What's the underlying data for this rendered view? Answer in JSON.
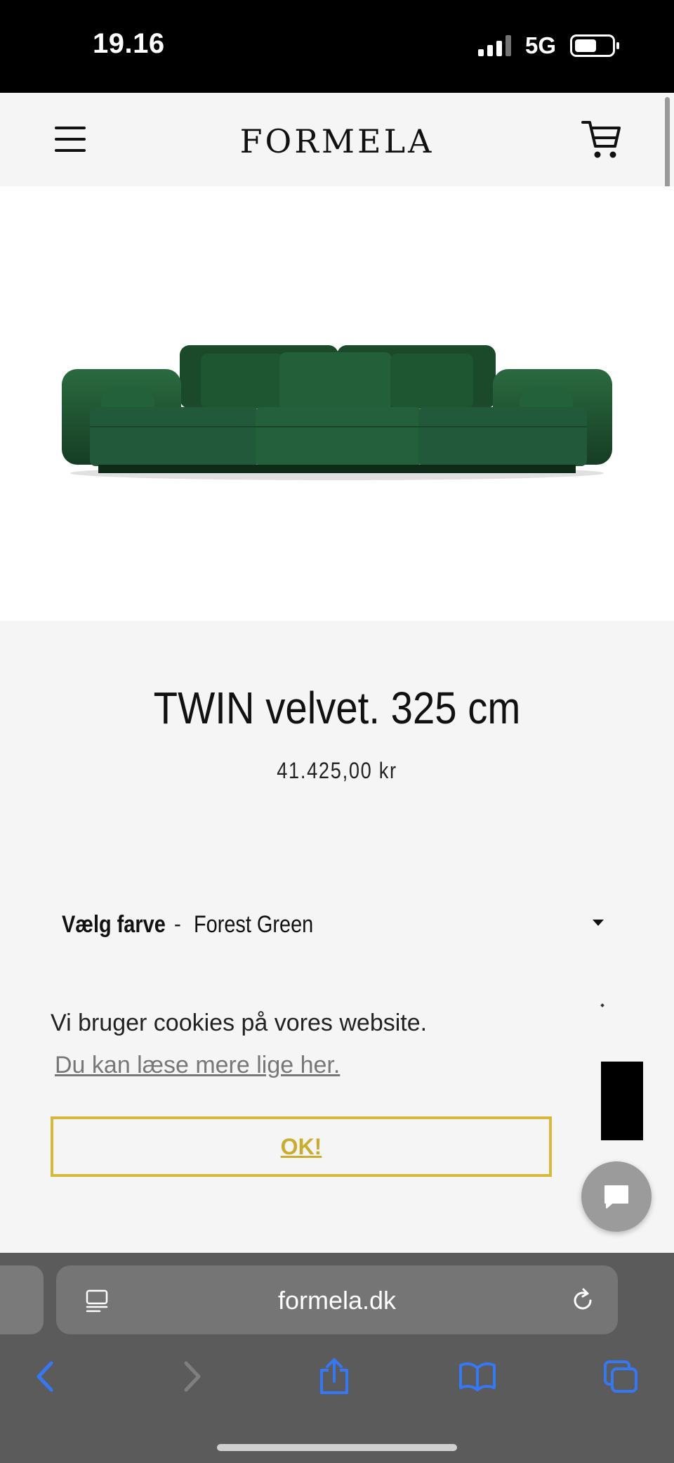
{
  "status_bar": {
    "time": "19.16",
    "network": "5G"
  },
  "header": {
    "logo": "FORMELA"
  },
  "product": {
    "title": "TWIN velvet. 325 cm",
    "price": "41.425,00 kr",
    "variant_label": "Vælg farve",
    "variant_separator": "-",
    "variant_value": "Forest Green",
    "sofa_color": "#1f4d2e"
  },
  "cookie": {
    "message": "Vi bruger cookies på vores website.",
    "link_text": "Du kan læse mere lige her.",
    "ok_label": "OK!",
    "accent_color": "#d4b93a"
  },
  "browser": {
    "url": "formela.dk"
  },
  "colors": {
    "browser_accent": "#3478f6"
  }
}
